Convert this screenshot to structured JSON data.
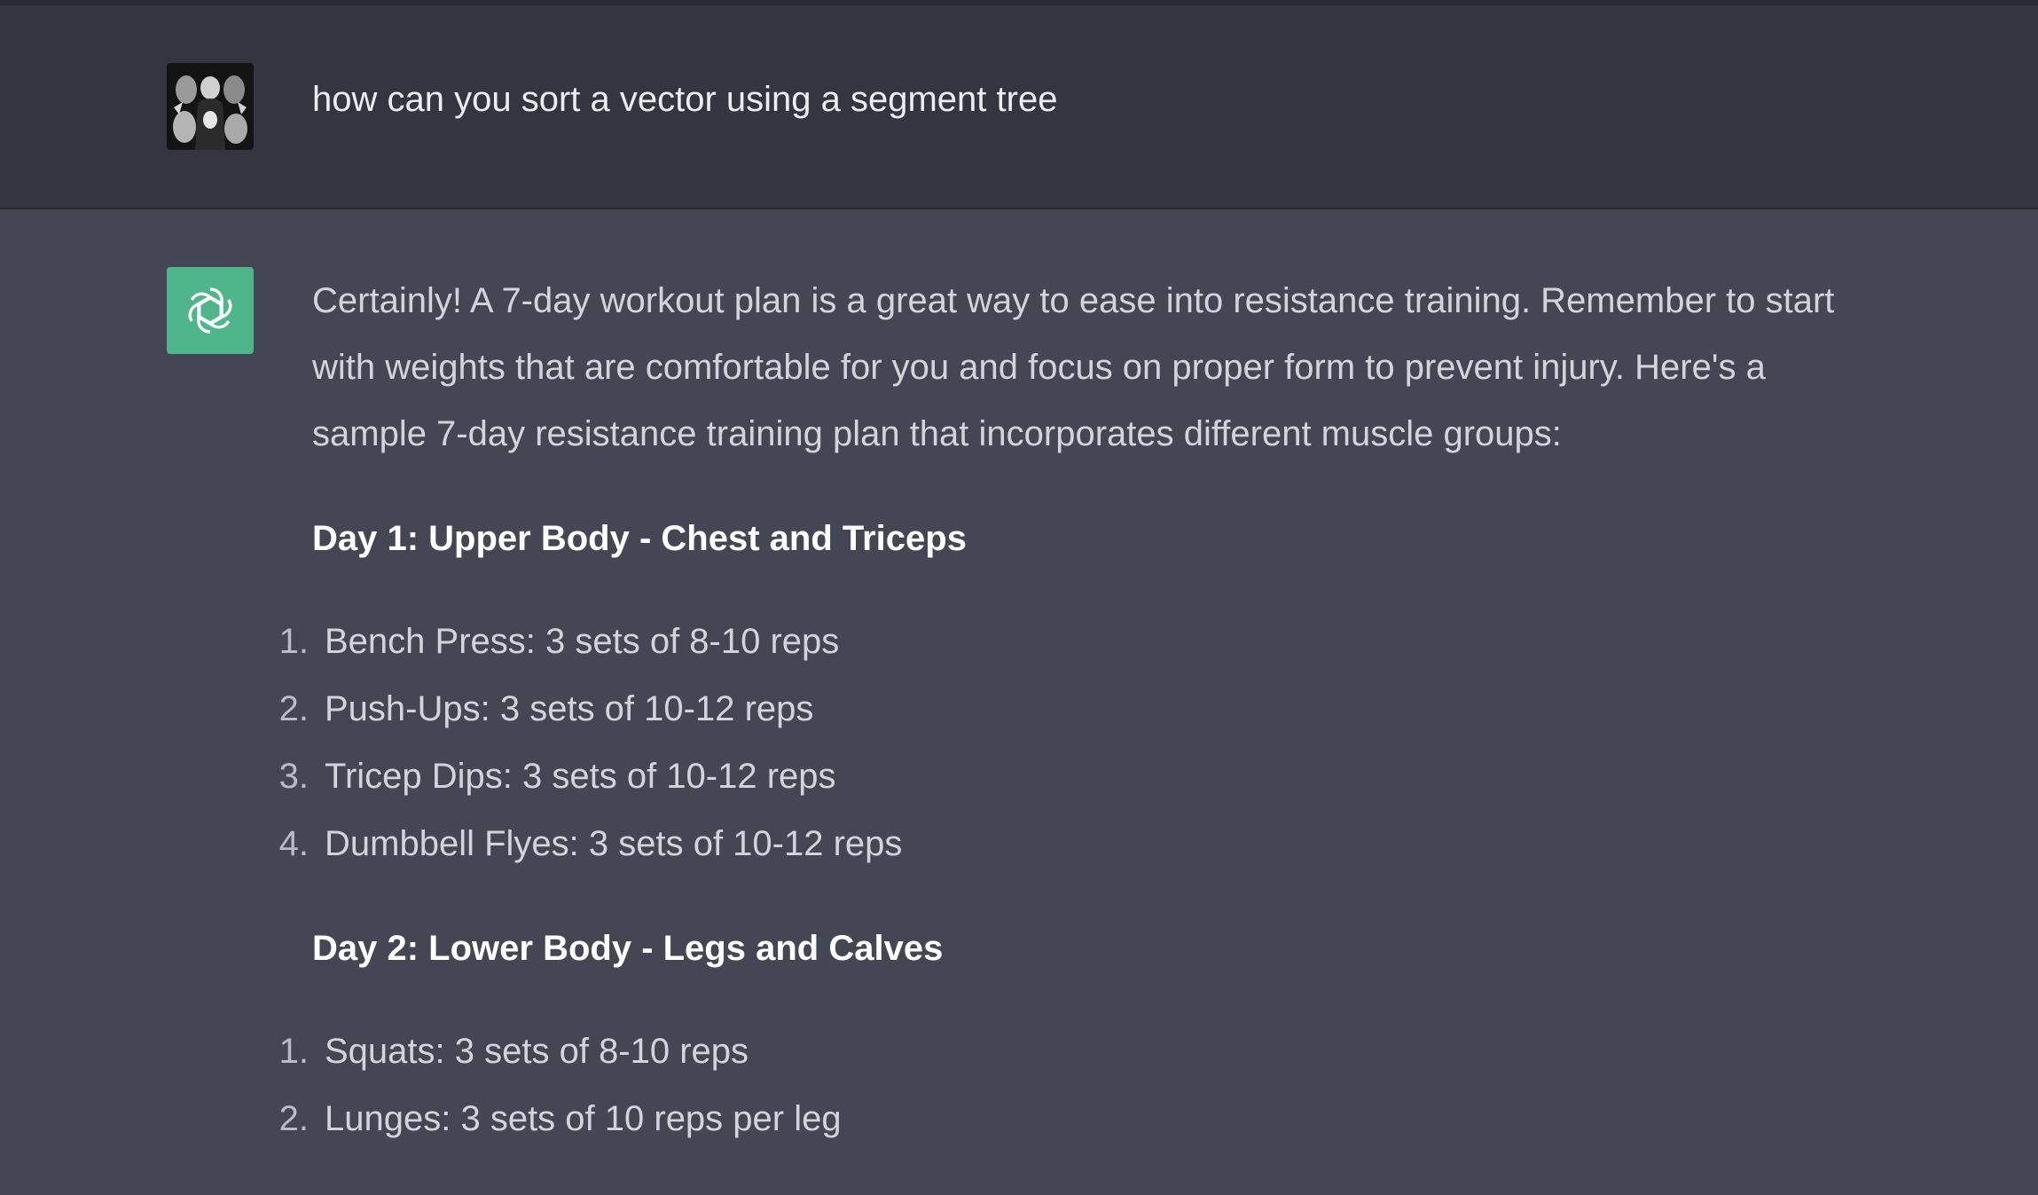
{
  "user_message": {
    "text": "how can you sort a vector using a segment tree"
  },
  "assistant_message": {
    "intro": "Certainly! A 7-day workout plan is a great way to ease into resistance training. Remember to start with weights that are comfortable for you and focus on proper form to prevent injury. Here's a sample 7-day resistance training plan that incorporates different muscle groups:",
    "days": [
      {
        "heading": "Day 1: Upper Body - Chest and Triceps",
        "items": [
          {
            "num": "1.",
            "text": "Bench Press: 3 sets of 8-10 reps"
          },
          {
            "num": "2.",
            "text": "Push-Ups: 3 sets of 10-12 reps"
          },
          {
            "num": "3.",
            "text": "Tricep Dips: 3 sets of 10-12 reps"
          },
          {
            "num": "4.",
            "text": "Dumbbell Flyes: 3 sets of 10-12 reps"
          }
        ]
      },
      {
        "heading": "Day 2: Lower Body - Legs and Calves",
        "items": [
          {
            "num": "1.",
            "text": "Squats: 3 sets of 8-10 reps"
          },
          {
            "num": "2.",
            "text": "Lunges: 3 sets of 10 reps per leg"
          }
        ]
      }
    ]
  },
  "icons": {
    "user_avatar": "user-avatar-image",
    "assistant_avatar": "openai-logo-icon"
  },
  "colors": {
    "user_row_bg": "#343541",
    "assistant_row_bg": "#444654",
    "assistant_avatar_bg": "#4fb58a",
    "heading_text": "#ffffff",
    "body_text": "#d1d5db"
  }
}
